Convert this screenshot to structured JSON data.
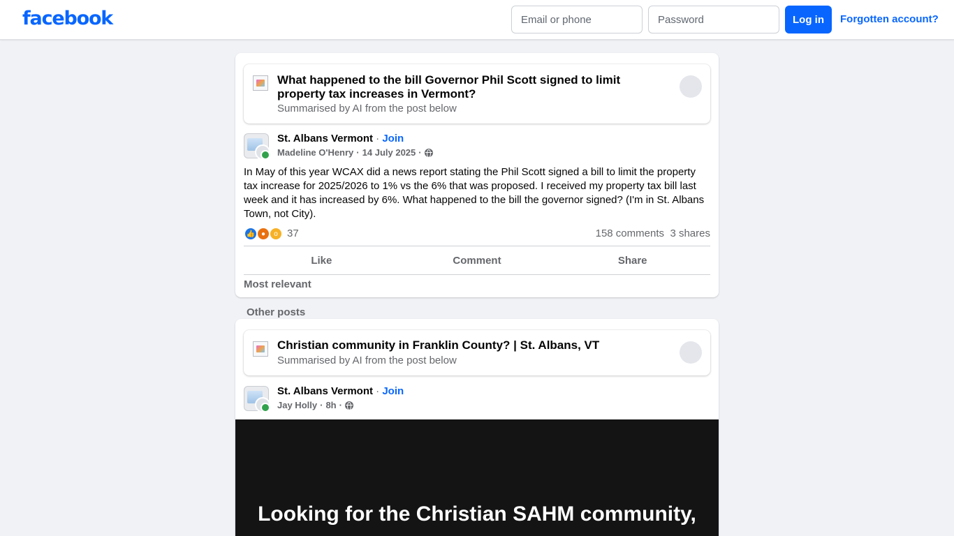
{
  "header": {
    "logo": "facebook",
    "email_placeholder": "Email or phone",
    "password_placeholder": "Password",
    "login_label": "Log in",
    "forgot_label": "Forgotten account?"
  },
  "post1": {
    "ai_title": "What happened to the bill Governor Phil Scott signed to limit property tax increases in Vermont?",
    "ai_sub": "Summarised by AI from the post below",
    "group": "St. Albans Vermont",
    "join": "Join",
    "author": "Madeline O'Henry",
    "date": "14 July 2025",
    "body": "In May of this year WCAX did a news report stating the Phil Scott signed a bill to limit the property tax increase for 2025/2026 to 1% vs the 6% that was proposed. I received my property tax bill last week and it has increased by 6%. What happened to the bill the governor signed? (I'm in St. Albans Town, not City).",
    "reaction_count": "37",
    "comments": "158 comments",
    "shares": "3 shares",
    "actions": [
      "Like",
      "Comment",
      "Share"
    ],
    "most_relevant": "Most relevant"
  },
  "other_posts_label": "Other posts",
  "post2": {
    "ai_title": "Christian community in Franklin County? | St. Albans, VT",
    "ai_sub": "Summarised by AI from the post below",
    "group": "St. Albans Vermont",
    "join": "Join",
    "author": "Jay Holly",
    "date": "8h",
    "image_text": "Looking for the Christian SAHM community,"
  },
  "colors": {
    "brand": "#0866ff",
    "background": "#f0f2f5",
    "secondary_text": "#65676b"
  }
}
